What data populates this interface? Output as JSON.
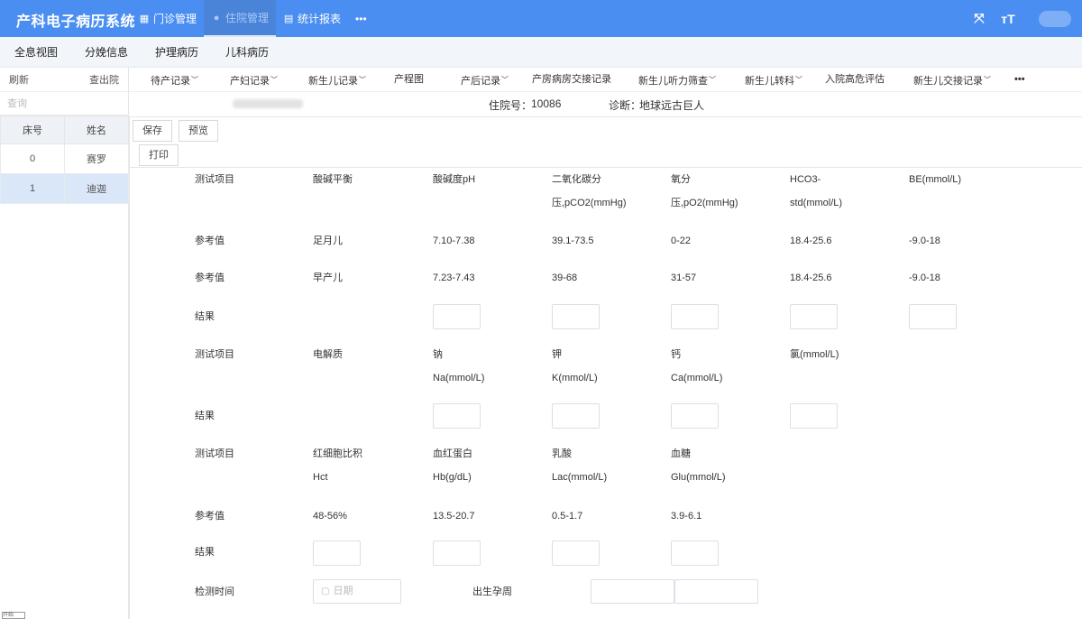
{
  "app": {
    "title": "产科电子病历系统"
  },
  "topnav": {
    "items": [
      {
        "label": "门诊管理",
        "icon": "grid-icon"
      },
      {
        "label": "住院管理",
        "icon": "user-icon"
      },
      {
        "label": "统计报表",
        "icon": "table-icon"
      }
    ],
    "more": "•••",
    "right_icons": [
      "fullscreen-icon",
      "font-size-icon"
    ]
  },
  "subtabs": [
    "全息视图",
    "分娩信息",
    "护理病历",
    "儿科病历"
  ],
  "left": {
    "refresh": "刷新",
    "discharged": "查出院",
    "search_placeholder": "查询",
    "columns": [
      "床号",
      "姓名"
    ],
    "rows": [
      {
        "bed": "0",
        "name": "赛罗"
      },
      {
        "bed": "1",
        "name": "迪迦"
      }
    ],
    "footer": "开始"
  },
  "toolbar": {
    "items": [
      "待产记录",
      "产妇记录",
      "新生儿记录",
      "产程图",
      "产后记录",
      "产房病房交接记录",
      "新生儿听力筛查",
      "新生儿转科",
      "入院高危评估",
      "新生儿交接记录"
    ],
    "more": "•••"
  },
  "patient": {
    "admission_label": "住院号：",
    "admission_no": "10086",
    "diagnosis_label": "诊断：",
    "diagnosis": "地球远古巨人"
  },
  "buttons": {
    "save": "保存",
    "preview": "预览",
    "print": "打印"
  },
  "section1": {
    "header": [
      "测试项目",
      "酸碱平衡",
      "酸碱度pH",
      "二氧化碳分",
      "氧分",
      "HCO3-",
      "BE(mmol/L)"
    ],
    "header_line2": [
      "",
      "",
      "",
      "压,pCO2(mmHg)",
      "压,pO2(mmHg)",
      "std(mmol/L)",
      ""
    ],
    "ref_full": [
      "参考值",
      "足月儿",
      "7.10-7.38",
      "39.1-73.5",
      "0-22",
      "18.4-25.6",
      "-9.0-18"
    ],
    "ref_preterm": [
      "参考值",
      "早产儿",
      "7.23-7.43",
      "39-68",
      "31-57",
      "18.4-25.6",
      "-9.0-18"
    ],
    "result_label": "结果"
  },
  "section2": {
    "header": [
      "测试项目",
      "电解质",
      "钠",
      "钾",
      "钙",
      "氯(mmol/L)"
    ],
    "header_line2": [
      "",
      "",
      "Na(mmol/L)",
      "K(mmol/L)",
      "Ca(mmol/L)",
      ""
    ],
    "result_label": "结果"
  },
  "section3": {
    "header": [
      "测试项目",
      "红细胞比积",
      "血红蛋白",
      "乳酸",
      "血糖"
    ],
    "header_line2": [
      "",
      "Hct",
      "Hb(g/dL)",
      "Lac(mmol/L)",
      "Glu(mmol/L)"
    ],
    "ref": [
      "参考值",
      "48-56%",
      "13.5-20.7",
      "0.5-1.7",
      "3.9-6.1"
    ],
    "result_label": "结果"
  },
  "footer_fields": {
    "time_label": "检测时间",
    "date_placeholder": "日期",
    "ga_label": "出生孕周"
  }
}
